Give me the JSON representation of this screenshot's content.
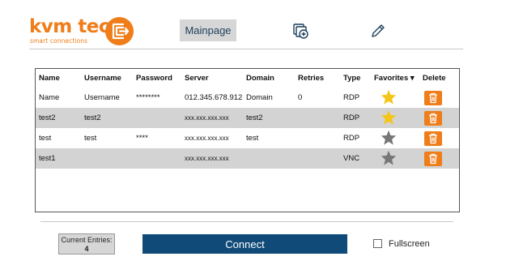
{
  "logo": {
    "brand": "kvm tec",
    "tagline": "smart connections"
  },
  "nav": {
    "mainpage_label": "Mainpage",
    "add_icon": "add-tab-icon",
    "edit_icon": "pencil-icon"
  },
  "table": {
    "headers": [
      "Name",
      "Username",
      "Password",
      "Server",
      "Domain",
      "Retries",
      "Type",
      "Favorites ▾",
      "Delete"
    ],
    "rows": [
      {
        "name": "Name",
        "username": "Username",
        "password": "********",
        "server": "012.345.678.912",
        "domain": "Domain",
        "retries": "0",
        "type": "RDP",
        "favorite": true
      },
      {
        "name": "test2",
        "username": "test2",
        "password": "",
        "server": "xxx.xxx.xxx.xxx",
        "domain": "test2",
        "retries": "",
        "type": "RDP",
        "favorite": true
      },
      {
        "name": "test",
        "username": "test",
        "password": "****",
        "server": "xxx.xxx.xxx.xxx",
        "domain": "test",
        "retries": "",
        "type": "RDP",
        "favorite": false
      },
      {
        "name": "test1",
        "username": "",
        "password": "",
        "server": "xxx.xxx.xxx.xxx",
        "domain": "",
        "retries": "",
        "type": "VNC",
        "favorite": false
      }
    ]
  },
  "footer": {
    "entries_label": "Current Entries:",
    "entries_count": "4",
    "connect_label": "Connect",
    "fullscreen_label": "Fullscreen",
    "fullscreen_checked": false
  },
  "colors": {
    "accent": "#ef7d1a",
    "primary": "#0f4a78",
    "star_on": "#f5c518",
    "star_off": "#777777"
  }
}
